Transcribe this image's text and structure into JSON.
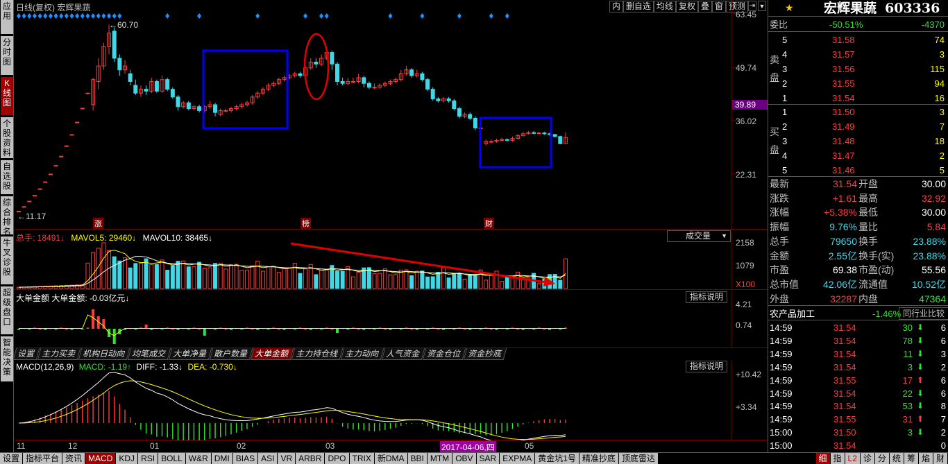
{
  "left_tabs": [
    {
      "label": "应用",
      "active": false
    },
    {
      "label": "分时图",
      "active": false
    },
    {
      "label": "K线图",
      "active": true
    },
    {
      "label": "个股资料",
      "active": false
    },
    {
      "label": "自选股",
      "active": false
    },
    {
      "label": "综合排名",
      "active": false
    },
    {
      "label": "牛叉诊股",
      "active": false
    },
    {
      "label": "超级盘口",
      "active": false
    },
    {
      "label": "智能决策",
      "active": false
    }
  ],
  "main": {
    "title": "日线(复权)  宏辉果蔬",
    "toolbar": [
      "内",
      "删自选",
      "均线",
      "复权",
      "叠",
      "窗",
      "预测"
    ],
    "price_labels": [
      "63.45",
      "49.74",
      "36.02",
      "22.31"
    ],
    "highlight_price": "39.89",
    "high_mark": "60.70",
    "low_mark": "11.17",
    "event_marks": [
      "涨",
      "榜",
      "财"
    ]
  },
  "volume": {
    "legend_total": "总手: 18491↓",
    "legend_ma5": "MAVOL5: 29460↓",
    "legend_ma10": "MAVOL10: 38465↓",
    "selector": "成交量",
    "labels": [
      "2158",
      "1079",
      "X100"
    ]
  },
  "bigorder": {
    "legend": "大单金额  大单金额: -0.03亿元↓",
    "button": "指标说明",
    "labels": [
      "4.21",
      "0.74"
    ]
  },
  "func_tabs": [
    "设置",
    "主力买卖",
    "机构日动向",
    "均笔成交",
    "大单净量",
    "散户数量",
    "大单金额",
    "主力持仓线",
    "主力动向",
    "人气资金",
    "资金仓位",
    "资金抄底"
  ],
  "func_tab_active": "大单金额",
  "macd": {
    "legend_name": "MACD(12,26,9)",
    "legend_macd": "MACD: -1.19↑",
    "legend_diff": "DIFF: -1.33↓",
    "legend_dea": "DEA: -0.730↓",
    "button": "指标说明",
    "labels": [
      "+10.42",
      "+3.34"
    ]
  },
  "xaxis": {
    "labels": [
      "11",
      "12",
      "01",
      "02",
      "03",
      "04",
      "05"
    ],
    "cursor_date": "2017-04-06,四"
  },
  "bottom_tabs": [
    "设置",
    "指标平台",
    "资讯",
    "MACD",
    "KDJ",
    "RSI",
    "BOLL",
    "W&R",
    "DMI",
    "BIAS",
    "ASI",
    "VR",
    "ARBR",
    "DPO",
    "TRIX",
    "新DMA",
    "BBI",
    "MTM",
    "OBV",
    "SAR",
    "EXPMA",
    "黄金坑1号",
    "精准抄底",
    "顶底雷达"
  ],
  "bottom_tab_active": "MACD",
  "bottom_right_tabs": [
    "细",
    "指",
    "L2",
    "诊",
    "分",
    "统",
    "筹",
    "焰",
    "财"
  ],
  "stock": {
    "name": "宏辉果蔬",
    "code": "603336"
  },
  "weibi": {
    "label": "委比",
    "pct": "-50.51%",
    "diff": "-4370"
  },
  "sell_label": "卖盘",
  "buy_label": "买盘",
  "sells": [
    {
      "lvl": "5",
      "price": "31.58",
      "vol": "74"
    },
    {
      "lvl": "4",
      "price": "31.57",
      "vol": "3"
    },
    {
      "lvl": "3",
      "price": "31.56",
      "vol": "115"
    },
    {
      "lvl": "2",
      "price": "31.55",
      "vol": "94"
    },
    {
      "lvl": "1",
      "price": "31.54",
      "vol": "16"
    }
  ],
  "buys": [
    {
      "lvl": "1",
      "price": "31.50",
      "vol": "3"
    },
    {
      "lvl": "2",
      "price": "31.49",
      "vol": "7"
    },
    {
      "lvl": "3",
      "price": "31.48",
      "vol": "18"
    },
    {
      "lvl": "4",
      "price": "31.47",
      "vol": "2"
    },
    {
      "lvl": "5",
      "price": "31.46",
      "vol": "5"
    }
  ],
  "quote": [
    {
      "l1": "最新",
      "v1": "31.54",
      "c1": "red",
      "l2": "开盘",
      "v2": "30.00",
      "c2": "white"
    },
    {
      "l1": "涨跌",
      "v1": "+1.61",
      "c1": "red",
      "l2": "最高",
      "v2": "32.92",
      "c2": "red"
    },
    {
      "l1": "涨幅",
      "v1": "+5.38%",
      "c1": "red",
      "l2": "最低",
      "v2": "30.00",
      "c2": "white"
    },
    {
      "l1": "振幅",
      "v1": "9.76%",
      "c1": "cyan",
      "l2": "量比",
      "v2": "5.84",
      "c2": "red"
    },
    {
      "l1": "总手",
      "v1": "79650",
      "c1": "cyan",
      "l2": "换手",
      "v2": "23.88%",
      "c2": "cyan"
    },
    {
      "l1": "金额",
      "v1": "2.55亿",
      "c1": "cyan",
      "l2": "换手(实)",
      "v2": "23.88%",
      "c2": "cyan"
    },
    {
      "l1": "市盈",
      "v1": "69.38",
      "c1": "white",
      "l2": "市盈(动)",
      "v2": "55.56",
      "c2": "white"
    },
    {
      "l1": "总市值",
      "v1": "42.06亿",
      "c1": "cyan",
      "l2": "流通值",
      "v2": "10.52亿",
      "c2": "cyan"
    },
    {
      "l1": "外盘",
      "v1": "32287",
      "c1": "red",
      "l2": "内盘",
      "v2": "47364",
      "c2": "green"
    }
  ],
  "sector": {
    "name": "农产品加工",
    "pct": "-1.46%",
    "button": "同行业比较"
  },
  "ticks": [
    {
      "t": "14:59",
      "p": "31.54",
      "pc": "red",
      "v": "30",
      "dir": "down",
      "n": "6"
    },
    {
      "t": "14:59",
      "p": "31.54",
      "pc": "red",
      "v": "78",
      "dir": "down",
      "n": "6"
    },
    {
      "t": "14:59",
      "p": "31.54",
      "pc": "red",
      "v": "11",
      "dir": "down",
      "n": "3"
    },
    {
      "t": "14:59",
      "p": "31.54",
      "pc": "red",
      "v": "3",
      "dir": "down",
      "n": "2"
    },
    {
      "t": "14:59",
      "p": "31.55",
      "pc": "red",
      "v": "17",
      "dir": "up",
      "n": "6"
    },
    {
      "t": "14:59",
      "p": "31.54",
      "pc": "red",
      "v": "22",
      "dir": "down",
      "n": "6"
    },
    {
      "t": "14:59",
      "p": "31.54",
      "pc": "red",
      "v": "53",
      "dir": "down",
      "n": "8"
    },
    {
      "t": "14:59",
      "p": "31.55",
      "pc": "red",
      "v": "31",
      "dir": "up",
      "n": "7"
    },
    {
      "t": "15:00",
      "p": "31.50",
      "pc": "red",
      "v": "3",
      "dir": "down",
      "n": "2"
    },
    {
      "t": "15:00",
      "p": "31.54",
      "pc": "red",
      "v": "",
      "dir": "",
      "n": "0"
    }
  ],
  "colors": {
    "up": "#ff3c3c",
    "down": "#41d7e6",
    "green": "#2ee62e",
    "frame": "#7a0000",
    "annot_box": "#0000ff",
    "annot_circle": "#e00000"
  },
  "chart_data": {
    "type": "candlestick",
    "title": "日线(复权) 宏辉果蔬",
    "ylim": [
      11.17,
      63.45
    ],
    "candles": [
      [
        12.5,
        12.5,
        12.5,
        12.5
      ],
      [
        13.7,
        13.7,
        13.7,
        13.7
      ],
      [
        15.1,
        15.1,
        15.1,
        15.1
      ],
      [
        16.6,
        16.6,
        16.6,
        16.6
      ],
      [
        18.3,
        18.3,
        18.3,
        18.3
      ],
      [
        20.1,
        20.1,
        20.1,
        20.1
      ],
      [
        22.1,
        22.1,
        22.1,
        22.1
      ],
      [
        24.3,
        24.3,
        24.3,
        24.3
      ],
      [
        26.7,
        26.7,
        26.7,
        26.7
      ],
      [
        29.4,
        29.4,
        29.4,
        29.4
      ],
      [
        32.3,
        32.3,
        32.3,
        32.3
      ],
      [
        35.5,
        35.5,
        35.5,
        35.5
      ],
      [
        39.1,
        39.1,
        39.1,
        39.1
      ],
      [
        43,
        43,
        43,
        43
      ],
      [
        40,
        46.5,
        47,
        38.5
      ],
      [
        46,
        50,
        52,
        44
      ],
      [
        50,
        55,
        56,
        49
      ],
      [
        55,
        58.5,
        60.7,
        53
      ],
      [
        59,
        52,
        60,
        51
      ],
      [
        52,
        49,
        53,
        47.5
      ],
      [
        49,
        50,
        51.5,
        48
      ],
      [
        48,
        46,
        49,
        45
      ],
      [
        45,
        43,
        46.5,
        42.5
      ],
      [
        43,
        44,
        45,
        42
      ],
      [
        44,
        43.5,
        45,
        42.5
      ],
      [
        43.5,
        46,
        47,
        43
      ],
      [
        46,
        43.5,
        46.5,
        43
      ],
      [
        43.5,
        46.5,
        47.5,
        43
      ],
      [
        46.5,
        44,
        47,
        43.5
      ],
      [
        44,
        42,
        44.5,
        41.5
      ],
      [
        42,
        39.5,
        42.5,
        38.5
      ],
      [
        39.5,
        40.5,
        41,
        39
      ],
      [
        40.5,
        39,
        41,
        38.5
      ],
      [
        39,
        39.5,
        40,
        38.5
      ],
      [
        39.5,
        38.5,
        40,
        38
      ],
      [
        38.5,
        39.5,
        40,
        38
      ],
      [
        39.5,
        40,
        41,
        39
      ],
      [
        40,
        38,
        40.5,
        37
      ],
      [
        37.5,
        38.5,
        39,
        37
      ],
      [
        38.5,
        38.5,
        39,
        38
      ],
      [
        38.5,
        39,
        39.5,
        38
      ],
      [
        39,
        39.5,
        40,
        38.5
      ],
      [
        39.5,
        40,
        40.5,
        39
      ],
      [
        40,
        40.5,
        41,
        39.5
      ],
      [
        40.5,
        42,
        42.5,
        40
      ],
      [
        42,
        43,
        43.5,
        41.5
      ],
      [
        43,
        44,
        44.5,
        42.5
      ],
      [
        44,
        45,
        45.5,
        43.5
      ],
      [
        45,
        45.5,
        46,
        44.5
      ],
      [
        45.5,
        46.5,
        47,
        45
      ],
      [
        46.5,
        47,
        47.5,
        46
      ],
      [
        47,
        47.5,
        48,
        46.5
      ],
      [
        47.5,
        48,
        48.5,
        47
      ],
      [
        48,
        47.5,
        48.5,
        47
      ],
      [
        47.5,
        49.5,
        50,
        47
      ],
      [
        49.5,
        51,
        52,
        49
      ],
      [
        51,
        50.5,
        52,
        49.5
      ],
      [
        50.5,
        52,
        53,
        50
      ],
      [
        52,
        53.5,
        55,
        51.5
      ],
      [
        53.5,
        50.5,
        54,
        49
      ],
      [
        50.5,
        46,
        51,
        45
      ],
      [
        46,
        45.5,
        47,
        45
      ],
      [
        45.5,
        46,
        47,
        45
      ],
      [
        46,
        46,
        47,
        45.5
      ],
      [
        46,
        47,
        48,
        45.5
      ],
      [
        47,
        45.5,
        47.5,
        44.5
      ],
      [
        45.5,
        44.5,
        46,
        44
      ],
      [
        44.5,
        44.5,
        45.5,
        44
      ],
      [
        44.5,
        45,
        45.5,
        44
      ],
      [
        45,
        45.5,
        46,
        44.5
      ],
      [
        45.5,
        46,
        46.5,
        45
      ],
      [
        46,
        46.5,
        47,
        45.5
      ],
      [
        46.5,
        48,
        49,
        46
      ],
      [
        48,
        49,
        50,
        47.5
      ],
      [
        49,
        47.5,
        49.5,
        47
      ],
      [
        47.5,
        48,
        49,
        47
      ],
      [
        48,
        46.5,
        48.5,
        46
      ],
      [
        46.5,
        44,
        47,
        43.5
      ],
      [
        44,
        41.5,
        44.5,
        41
      ],
      [
        41.5,
        41,
        42,
        40.5
      ],
      [
        41,
        41.5,
        42,
        40.5
      ],
      [
        41.5,
        41,
        42,
        40.5
      ],
      [
        41,
        39,
        41.5,
        38.5
      ],
      [
        39,
        37,
        39.5,
        36.5
      ],
      [
        37,
        37.5,
        38,
        36.5
      ],
      [
        37.5,
        36.5,
        38,
        36
      ],
      [
        36.5,
        34,
        37,
        33.5
      ],
      [
        34,
        34,
        34.5,
        33.5
      ],
      [
        30,
        30.5,
        31,
        29.5
      ],
      [
        30.5,
        30.5,
        31,
        30
      ],
      [
        30.5,
        30.8,
        31.2,
        30.2
      ],
      [
        30.8,
        31,
        31.5,
        30.5
      ],
      [
        31,
        30.8,
        31.3,
        30.5
      ],
      [
        30.8,
        31.3,
        31.8,
        30.5
      ],
      [
        31.3,
        32,
        32.5,
        31
      ],
      [
        32,
        32.5,
        33,
        31.8
      ],
      [
        32.5,
        32.8,
        33.2,
        32.3
      ],
      [
        32.8,
        32.6,
        33.2,
        32.3
      ],
      [
        32.6,
        32.7,
        33,
        32.3
      ],
      [
        32.7,
        32.5,
        33,
        32.2
      ],
      [
        32.5,
        32.3,
        32.8,
        32
      ],
      [
        32.3,
        31.8,
        32.5,
        31.5
      ],
      [
        31.8,
        29.93,
        32,
        29.8
      ],
      [
        30,
        31.54,
        32.92,
        30
      ]
    ],
    "volume_max": 2158,
    "macd_range": [
      -2,
      10.42
    ]
  }
}
